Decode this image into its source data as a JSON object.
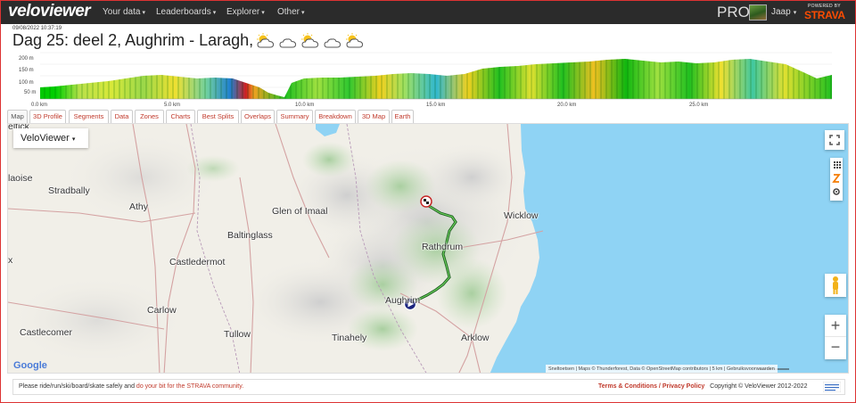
{
  "nav": {
    "logo": "veloviewer",
    "items": [
      "Your data",
      "Leaderboards",
      "Explorer",
      "Other"
    ],
    "pro": "PRO",
    "user": "Jaap",
    "powered_by": "POWERED BY",
    "strava": "STRAVA",
    "caret": "▾"
  },
  "activity": {
    "timestamp": "09/08/2022 10:37:19",
    "title": "Dag 25: deel 2, Aughrim - Laragh,"
  },
  "elevation": {
    "y_ticks": [
      "200 m",
      "150 m",
      "100 m",
      "50 m"
    ],
    "x_ticks": [
      "0.0 km",
      "5.0 km",
      "10.0 km",
      "15.0 km",
      "20.0 km",
      "25.0 km"
    ]
  },
  "tabs": [
    "Map",
    "3D Profile",
    "Segments",
    "Data",
    "Zones",
    "Charts",
    "Best Splits",
    "Overlaps",
    "Summary",
    "Breakdown",
    "3D Map",
    "Earth"
  ],
  "map": {
    "style_select": "VeloViewer",
    "places": [
      {
        "name": "Celbridge",
        "label": "eltick"
      },
      {
        "name": "Portlaoise",
        "label": "laoise"
      },
      {
        "name": "Stradbally",
        "label": "Stradbally"
      },
      {
        "name": "Athy",
        "label": "Athy"
      },
      {
        "name": "Glen of Imaal",
        "label": "Glen of Imaal"
      },
      {
        "name": "Wicklow",
        "label": "Wicklow"
      },
      {
        "name": "Baltinglass",
        "label": "Baltinglass"
      },
      {
        "name": "Rathdrum",
        "label": "Rathdrum"
      },
      {
        "name": "Castledermot",
        "label": "Castledermot"
      },
      {
        "name": "Aughrim",
        "label": "Aughrim"
      },
      {
        "name": "Carlow",
        "label": "Carlow"
      },
      {
        "name": "Tullow",
        "label": "Tullow"
      },
      {
        "name": "Castlecomer",
        "label": "Castlecomer"
      },
      {
        "name": "Tinahely",
        "label": "Tinahely"
      },
      {
        "name": "Arklow",
        "label": "Arklow"
      },
      {
        "name": "x",
        "label": "x"
      }
    ],
    "attribution": "Sneltoetsen | Maps © Thunderforest, Data © OpenStreetMap contributors | 5 km | Gebruiksvoorwaarden",
    "google": "Google",
    "zoom_in": "+",
    "zoom_out": "−"
  },
  "footer": {
    "left_text": "Please ride/run/ski/board/skate safely and",
    "left_link": "do your bit for the STRAVA community.",
    "terms": "Terms & Conditions / Privacy Policy",
    "copyright": "Copyright © VeloViewer 2012-2022"
  },
  "colors": {
    "nav_bg": "#2b2b2b",
    "strava": "#fc4c02",
    "tab_link": "#c0392b",
    "sea": "#8fd3f4",
    "route": "#2e7d32"
  }
}
